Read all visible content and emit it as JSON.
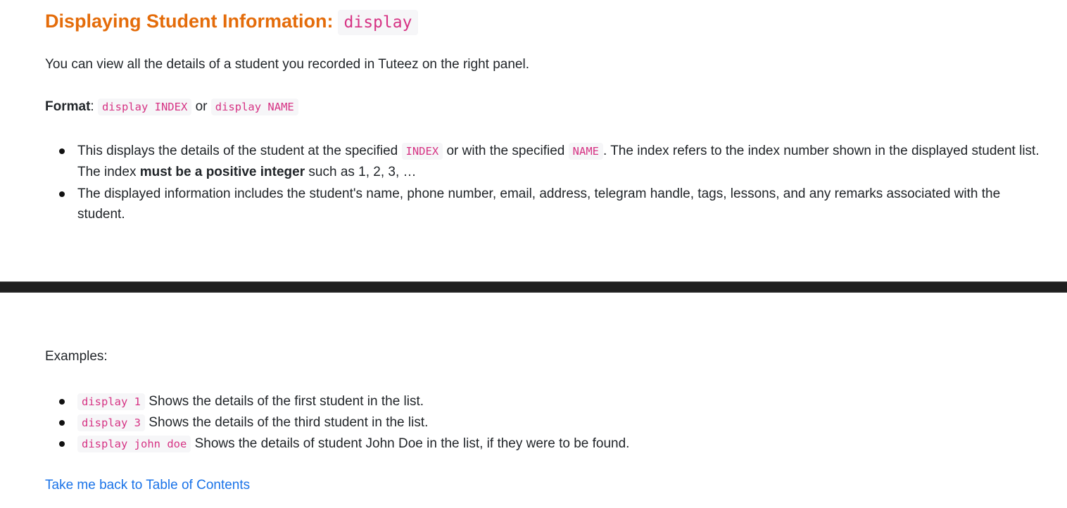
{
  "heading": {
    "title": "Displaying Student Information:",
    "command": "display"
  },
  "intro": "You can view all the details of a student you recorded in Tuteez on the right panel.",
  "format": {
    "label": "Format",
    "colon": ":",
    "cmd1": "display INDEX",
    "or": "or",
    "cmd2": "display NAME"
  },
  "bullets": {
    "b1_part1": "This displays the details of the student at the specified",
    "b1_code1": "INDEX",
    "b1_part2": "or with the specified",
    "b1_code2": "NAME",
    "b1_part3": ". The index refers to the index number shown in the displayed student list. The index",
    "b1_bold": "must be a positive integer",
    "b1_part4": "such as 1, 2, 3, …",
    "b2": "The displayed information includes the student's name, phone number, email, address, telegram handle, tags, lessons, and any remarks associated with the student."
  },
  "examples_label": "Examples:",
  "examples": [
    {
      "code": "display 1",
      "text": "Shows the details of the first student in the list."
    },
    {
      "code": "display 3",
      "text": "Shows the details of the third student in the list."
    },
    {
      "code": "display john doe",
      "text": "Shows the details of student John Doe in the list, if they were to be found."
    }
  ],
  "toc_link": "Take me back to Table of Contents",
  "colors": {
    "heading": "#e46c0a",
    "code": "#d63384",
    "link": "#1a73e8"
  }
}
